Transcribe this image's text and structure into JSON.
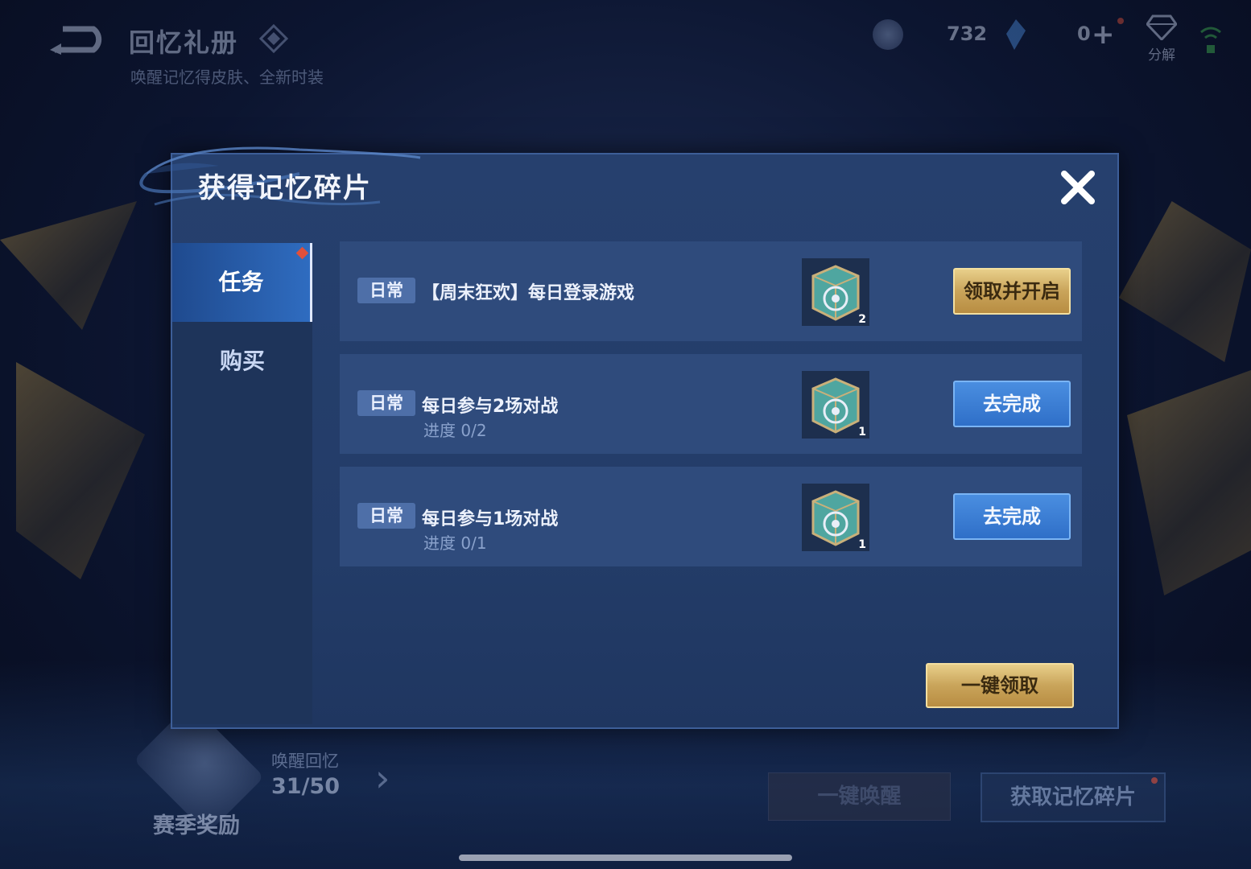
{
  "header": {
    "title": "回忆礼册",
    "subtitle": "唤醒记忆得皮肤、全新时装",
    "coin_value": "732",
    "gem_value": "0",
    "decompose_label": "分解"
  },
  "bottom": {
    "season_label": "赛季奖励",
    "awaken_label": "唤醒回忆",
    "awaken_count": "31/50",
    "onekey_awaken_label": "一键唤醒",
    "get_shards_label": "获取记忆碎片"
  },
  "modal": {
    "title": "获得记忆碎片",
    "tabs": [
      {
        "label": "任务",
        "active": true
      },
      {
        "label": "购买",
        "active": false
      }
    ],
    "tasks": [
      {
        "tag": "日常",
        "name": "【周末狂欢】每日登录游戏",
        "progress": "",
        "reward_count": "2",
        "button": "领取并开启",
        "button_style": "gold"
      },
      {
        "tag": "日常",
        "name": "每日参与2场对战",
        "progress": "进度 0/2",
        "reward_count": "1",
        "button": "去完成",
        "button_style": "blue"
      },
      {
        "tag": "日常",
        "name": "每日参与1场对战",
        "progress": "进度 0/1",
        "reward_count": "1",
        "button": "去完成",
        "button_style": "blue"
      }
    ],
    "claim_all_label": "一键领取"
  },
  "icons": {
    "back": "back-arrow-icon",
    "close": "close-icon",
    "reward": "memory-chest-icon"
  },
  "colors": {
    "gold_button": "#c9a45a",
    "blue_button": "#2f6fc8",
    "modal_bg": "#233c68",
    "tag_bg": "#4e6fa8",
    "notify_dot": "#e0503a"
  }
}
